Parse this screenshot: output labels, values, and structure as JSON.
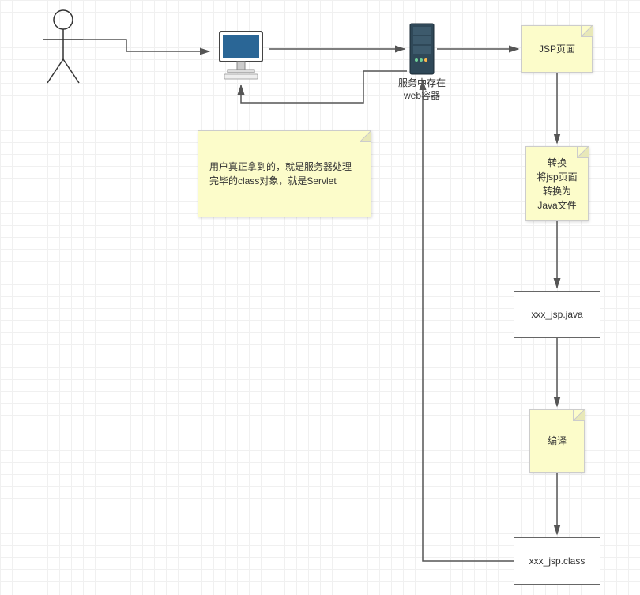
{
  "actor": {
    "label": "user"
  },
  "computer": {
    "label": "client"
  },
  "server": {
    "caption_line1": "服务中存在",
    "caption_line2": "web容器"
  },
  "note_main": {
    "text": "用户真正拿到的，就是服务器处理完毕的class对象，就是Servlet"
  },
  "right": {
    "jsp_page": "JSP页面",
    "convert_line1": "转换",
    "convert_line2": "将jsp页面",
    "convert_line3": "转换为",
    "convert_line4": "Java文件",
    "java_file": "xxx_jsp.java",
    "compile": "编译",
    "class_file": "xxx_jsp.class"
  }
}
